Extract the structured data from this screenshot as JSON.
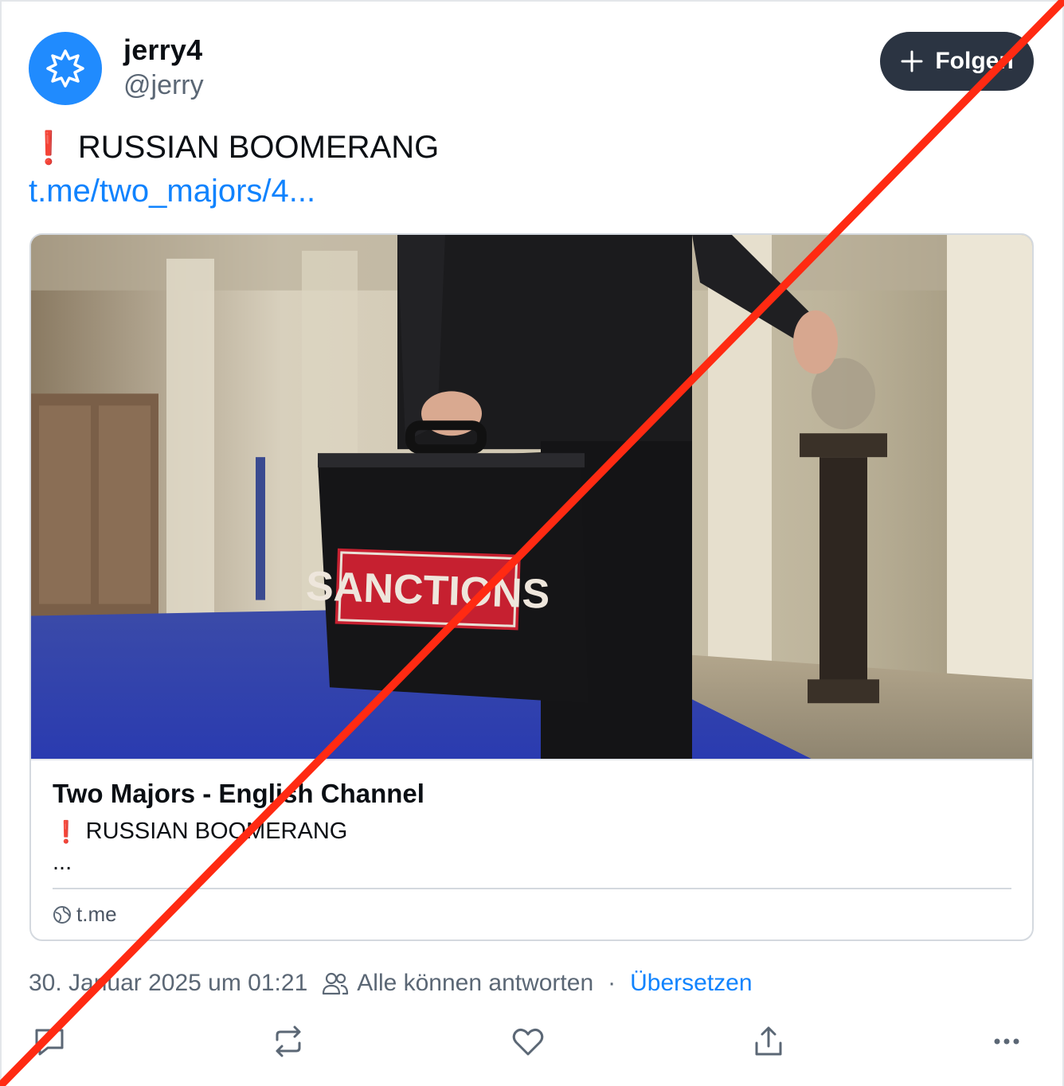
{
  "author": {
    "display_name": "jerry4",
    "handle": "@jerry",
    "avatar_icon": "starburst-icon",
    "avatar_color": "#208bfe"
  },
  "follow_button": {
    "label": "Folgen",
    "icon": "plus-icon"
  },
  "post": {
    "emoji": "❗",
    "text": "RUSSIAN BOOMERANG",
    "link_text": "t.me/two_majors/4..."
  },
  "link_card": {
    "image_text": "SANCTIONS",
    "title": "Two Majors - English Channel",
    "emoji": "❗",
    "description": "RUSSIAN BOOMERANG",
    "description_more": "...",
    "domain": "t.me",
    "domain_icon": "globe-icon"
  },
  "meta": {
    "timestamp": "30. Januar 2025 um 01:21",
    "reply_setting": "Alle können antworten",
    "separator": "·",
    "translate": "Übersetzen"
  },
  "actions": [
    "reply-icon",
    "repost-icon",
    "like-icon",
    "share-icon",
    "more-icon"
  ],
  "colors": {
    "accent": "#1083fe",
    "follow_button_bg": "#2b3442",
    "overlay_cross": "#ff2a12"
  }
}
